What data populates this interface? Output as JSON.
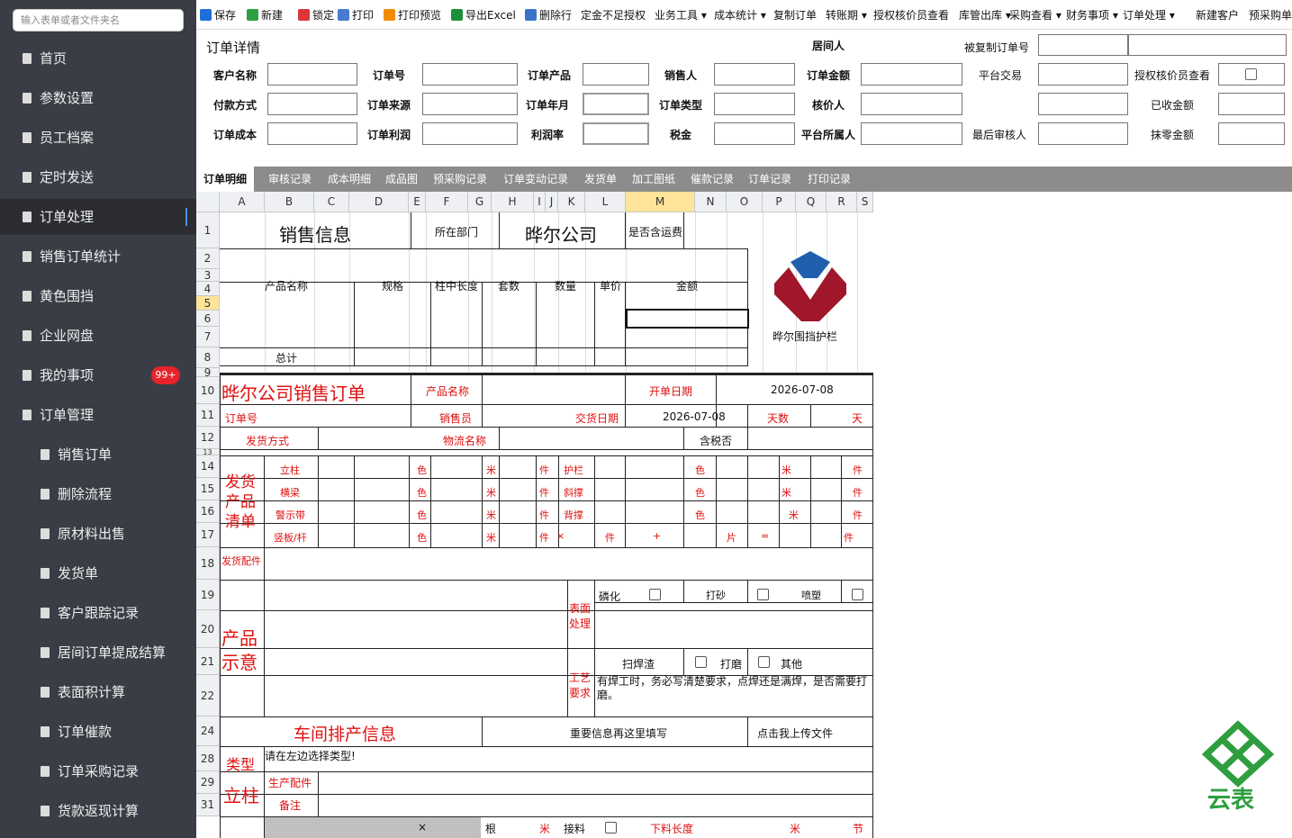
{
  "search": {
    "placeholder": "输入表单或者文件夹名"
  },
  "sidebar": {
    "items": [
      {
        "label": "首页",
        "icon": "home-icon"
      },
      {
        "label": "参数设置",
        "icon": "document-icon"
      },
      {
        "label": "员工档案",
        "icon": "document-icon"
      },
      {
        "label": "定时发送",
        "icon": "document-icon"
      },
      {
        "label": "订单处理",
        "icon": "document-icon",
        "active": true
      },
      {
        "label": "销售订单统计",
        "icon": "document-icon"
      },
      {
        "label": "黄色围挡",
        "icon": "document-icon"
      },
      {
        "label": "企业网盘",
        "icon": "folder-icon"
      },
      {
        "label": "我的事项",
        "icon": "folder-icon",
        "badge": "99+"
      },
      {
        "label": "订单管理",
        "icon": "edit-icon"
      },
      {
        "label": "销售订单",
        "icon": "document-icon",
        "sub": true
      },
      {
        "label": "删除流程",
        "icon": "document-icon",
        "sub": true
      },
      {
        "label": "原材料出售",
        "icon": "document-icon",
        "sub": true
      },
      {
        "label": "发货单",
        "icon": "document-icon",
        "sub": true
      },
      {
        "label": "客户跟踪记录",
        "icon": "document-icon",
        "sub": true
      },
      {
        "label": "居间订单提成结算",
        "icon": "document-icon",
        "sub": true
      },
      {
        "label": "表面积计算",
        "icon": "document-icon",
        "sub": true
      },
      {
        "label": "订单催款",
        "icon": "document-icon",
        "sub": true
      },
      {
        "label": "订单采购记录",
        "icon": "document-icon",
        "sub": true
      },
      {
        "label": "货款返现计算",
        "icon": "document-icon",
        "sub": true
      }
    ]
  },
  "toolbar": {
    "items": [
      {
        "label": "保存",
        "icon": "save-icon",
        "color": "#1e6fd9"
      },
      {
        "label": "新建",
        "icon": "new-icon",
        "color": "#2ea043"
      },
      {
        "label": "锁定",
        "icon": "lock-icon",
        "color": "#d9363e"
      },
      {
        "label": "打印",
        "icon": "print-icon",
        "color": "#4a7bd0"
      },
      {
        "label": "打印预览",
        "icon": "print-preview-icon",
        "color": "#f08c00"
      },
      {
        "label": "导出Excel",
        "icon": "excel-icon",
        "color": "#1d8f3a"
      },
      {
        "label": "删除行",
        "icon": "delete-row-icon",
        "color": "#3b73c8"
      },
      {
        "label": "定金不足授权"
      },
      {
        "label": "业务工具 ▾"
      },
      {
        "label": "成本统计 ▾"
      },
      {
        "label": "复制订单"
      },
      {
        "label": "转账期 ▾"
      },
      {
        "label": "授权核价员查看"
      },
      {
        "label": "库管出库 ▾"
      },
      {
        "label": "采购查看 ▾"
      },
      {
        "label": "财务事项 ▾"
      },
      {
        "label": "订单处理 ▾"
      },
      {
        "label": "新建客户"
      },
      {
        "label": "预采购单"
      }
    ]
  },
  "header": {
    "title": "订单详情",
    "labels": {
      "agent": "居间人",
      "copied": "被复制订单号",
      "customer": "客户名称",
      "order_no": "订单号",
      "product": "订单产品",
      "sales": "销售人",
      "amount": "订单金额",
      "platform": "平台交易",
      "authorize": "授权核价员查看",
      "payment": "付款方式",
      "source": "订单来源",
      "ym": "订单年月",
      "type": "订单类型",
      "pricer": "核价人",
      "received": "已收金额",
      "cost": "订单成本",
      "profit": "订单利润",
      "margin": "利润率",
      "tax": "税金",
      "owner": "平台所属人",
      "last_review": "最后审核人",
      "writeoff": "抹零金额"
    }
  },
  "tabs": [
    "订单明细",
    "审核记录",
    "成本明细",
    "成品图",
    "预采购记录",
    "订单变动记录",
    "发货单",
    "加工图纸",
    "催款记录",
    "订单记录",
    "打印记录"
  ],
  "sheet": {
    "columns": [
      "A",
      "B",
      "C",
      "D",
      "E",
      "F",
      "G",
      "H",
      "I",
      "J",
      "K",
      "L",
      "M",
      "N",
      "O",
      "P",
      "Q",
      "R",
      "S"
    ],
    "rows": [
      "1",
      "2",
      "3",
      "4",
      "5",
      "6",
      "7",
      "8",
      "9",
      "10",
      "11",
      "12",
      "13",
      "14",
      "15",
      "16",
      "17",
      "18",
      "19",
      "20",
      "21",
      "22",
      "24",
      "28",
      "29",
      "31"
    ],
    "r1": {
      "title": "销售信息",
      "dept_label": "所在部门",
      "company": "晔尔公司",
      "freight": "是否含运费"
    },
    "r3": {
      "h1": "产品名称",
      "h2": "规格",
      "h3": "柱中长度",
      "h4": "套数",
      "h5": "数量",
      "h6": "单价",
      "h7": "金额"
    },
    "r7": {
      "total": "总计"
    },
    "logo_text": "晔尔围挡护栏",
    "r9": {
      "title": "晔尔公司销售订单",
      "product": "产品名称",
      "open_date_label": "开单日期",
      "open_date": "2026-07-08"
    },
    "r10": {
      "order_no": "订单号",
      "sales": "销售员",
      "deliver_label": "交货日期",
      "deliver_date": "2026-07-08",
      "days": "天数",
      "day_unit": "天"
    },
    "r11": {
      "shipping": "发货方式",
      "logistics": "物流名称",
      "tax": "含税否"
    },
    "ship_list": "发货产品清单",
    "r13": {
      "a": "立柱",
      "b": "色",
      "c": "米",
      "d": "件",
      "e": "护栏",
      "f": "色",
      "g": "米",
      "h": "件"
    },
    "r14": {
      "a": "横梁",
      "b": "色",
      "c": "米",
      "d": "件",
      "e": "斜撑",
      "f": "色",
      "g": "米",
      "h": "件"
    },
    "r15": {
      "a": "警示带",
      "b": "色",
      "c": "米",
      "d": "件",
      "e": "背撑",
      "f": "色",
      "g": "米",
      "h": "件"
    },
    "r16": {
      "a": "竖板/杆",
      "b": "色",
      "c": "米",
      "d": "件",
      "x": "×",
      "e": "件",
      "plus": "+",
      "f": "片",
      "eq": "=",
      "g": "件"
    },
    "r17": {
      "accessory": "发货配件"
    },
    "product_sketch": "产品示意",
    "surface": "表面处理",
    "r18": {
      "phos": "磷化",
      "sand": "打砂",
      "spray": "喷塑"
    },
    "r20": {
      "slag": "扫焊渣",
      "grind": "打磨",
      "other": "其他"
    },
    "craft": "工艺要求",
    "r21": {
      "note": "有焊工时，务必写清楚要求，点焊还是满焊，是否需要打磨。"
    },
    "r22": {
      "title": "车间排产信息",
      "important": "重要信息再这里填写",
      "upload": "点击我上传文件"
    },
    "r24": {
      "type_label": "类型",
      "hint": "请在左边选择类型!"
    },
    "pillar": "立柱",
    "r28": {
      "parts": "生产配件"
    },
    "r29": {
      "remark": "备注"
    },
    "r31": {
      "x": "×",
      "root": "根",
      "m": "米",
      "joint": "接料",
      "cut": "下料长度",
      "m2": "米",
      "section": "节"
    }
  },
  "brand": {
    "text": "云表",
    "color": "#2e9e3f"
  }
}
